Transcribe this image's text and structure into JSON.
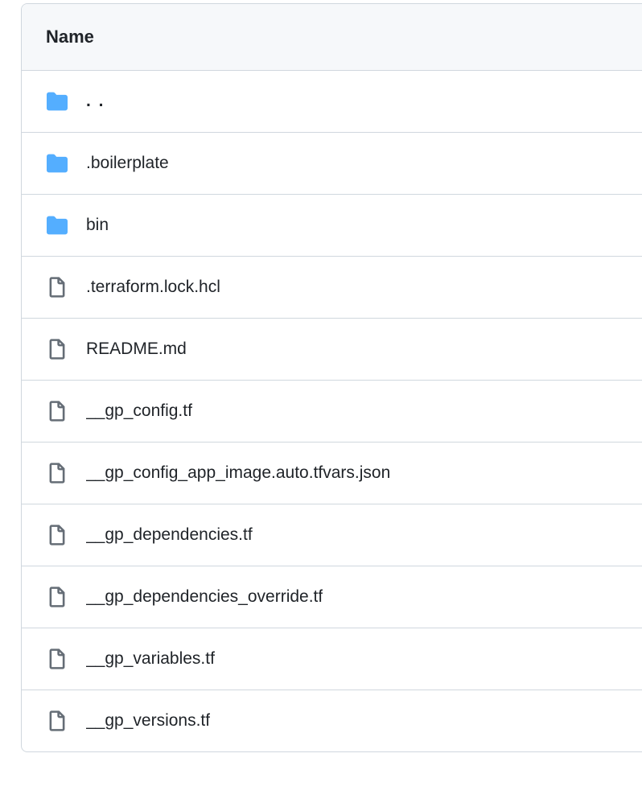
{
  "header": {
    "name_column": "Name"
  },
  "items": [
    {
      "type": "parent",
      "name": ". ."
    },
    {
      "type": "folder",
      "name": ".boilerplate"
    },
    {
      "type": "folder",
      "name": "bin"
    },
    {
      "type": "file",
      "name": ".terraform.lock.hcl"
    },
    {
      "type": "file",
      "name": "README.md"
    },
    {
      "type": "file",
      "name": "__gp_config.tf"
    },
    {
      "type": "file",
      "name": "__gp_config_app_image.auto.tfvars.json"
    },
    {
      "type": "file",
      "name": "__gp_dependencies.tf"
    },
    {
      "type": "file",
      "name": "__gp_dependencies_override.tf"
    },
    {
      "type": "file",
      "name": "__gp_variables.tf"
    },
    {
      "type": "file",
      "name": "__gp_versions.tf"
    }
  ]
}
